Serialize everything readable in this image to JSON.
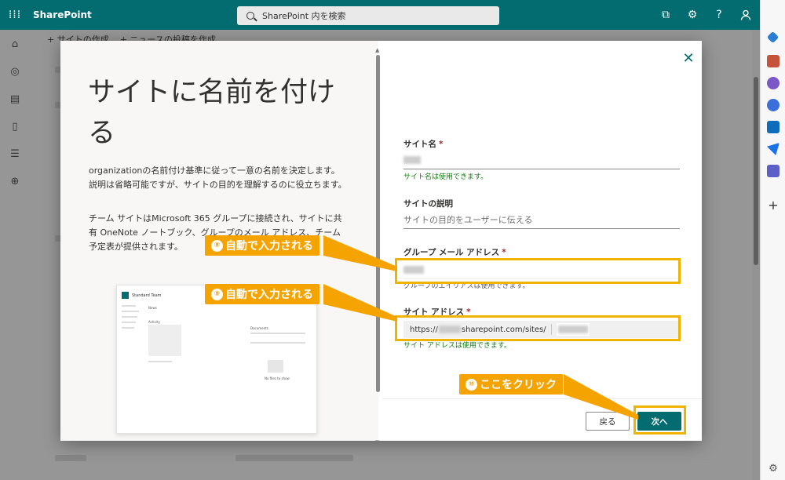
{
  "app": {
    "brand": "SharePoint",
    "search_placeholder": "SharePoint 内を検索"
  },
  "commandbar": {
    "create_site": "+ サイトの作成",
    "create_news": "+ ニュースの投稿を作成"
  },
  "dialog": {
    "title": "サイトに名前を付ける",
    "description_1": "organizationの名前付け基準に従って一意の名前を決定します。説明は省略可能ですが、サイトの目的を理解するのに役立ちます。",
    "description_2": "チーム サイトはMicrosoft 365 グループに接続され、サイトに共有 OneNote ノートブック、グループのメール アドレス、チーム予定表が提供されます。",
    "preview": {
      "site_name": "Standard Team",
      "news": "News",
      "activity": "Activity",
      "documents": "Documents",
      "no_files": "No files to show"
    },
    "fields": {
      "site_name_label": "サイト名",
      "site_name_msg": "サイト名は使用できます。",
      "description_label": "サイトの説明",
      "description_placeholder": "サイトの目的をユーザーに伝える",
      "group_email_label": "グループ メール アドレス",
      "group_email_msg": "グループのエイリアスは使用できます。",
      "site_address_label": "サイト アドレス",
      "site_address_prefix": "https://",
      "site_address_domain": "sharepoint.com/sites/",
      "site_address_msg": "サイト アドレスは使用できます。"
    },
    "buttons": {
      "back": "戻る",
      "next": "次へ"
    }
  },
  "annotations": {
    "auto1": "自動で入力される",
    "auto1_num": "⑧",
    "auto2": "自動で入力される",
    "auto2_num": "⑨",
    "click": "ここをクリック",
    "click_num": "⑩"
  },
  "colors": {
    "brand": "#036c70",
    "highlight": "#f0b400",
    "callout": "#f5a300",
    "success": "#107c10",
    "required": "#a4262c"
  },
  "icons": {
    "topbar": [
      "waffle-icon",
      "share-icon",
      "settings-icon",
      "help-icon",
      "profile-icon"
    ],
    "leftrail": [
      "home-icon",
      "globe-icon",
      "news-icon",
      "file-icon",
      "list-icon",
      "add-circle-icon"
    ]
  }
}
